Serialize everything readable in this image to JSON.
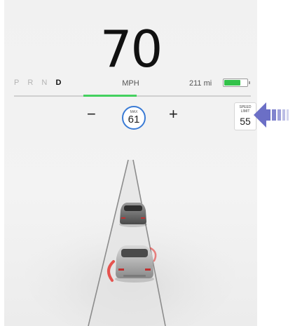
{
  "gear": {
    "items": [
      "P",
      "R",
      "N",
      "D"
    ],
    "active": "D"
  },
  "speed": {
    "value": "70",
    "unit": "MPH"
  },
  "range": {
    "text": "211 mi"
  },
  "battery": {
    "level": 0.75,
    "color": "#33c24a"
  },
  "cruise": {
    "decrease_label": "−",
    "increase_label": "+",
    "max_label": "MAX",
    "max_value": "61",
    "ring_color": "#3a7bd5"
  },
  "speed_limit": {
    "label_line1": "SPEED",
    "label_line2": "LIMIT",
    "value": "55"
  },
  "callout": {
    "icon": "arrow-left-icon",
    "color": "#6b6fc6"
  },
  "accent_color": "#44d15f"
}
